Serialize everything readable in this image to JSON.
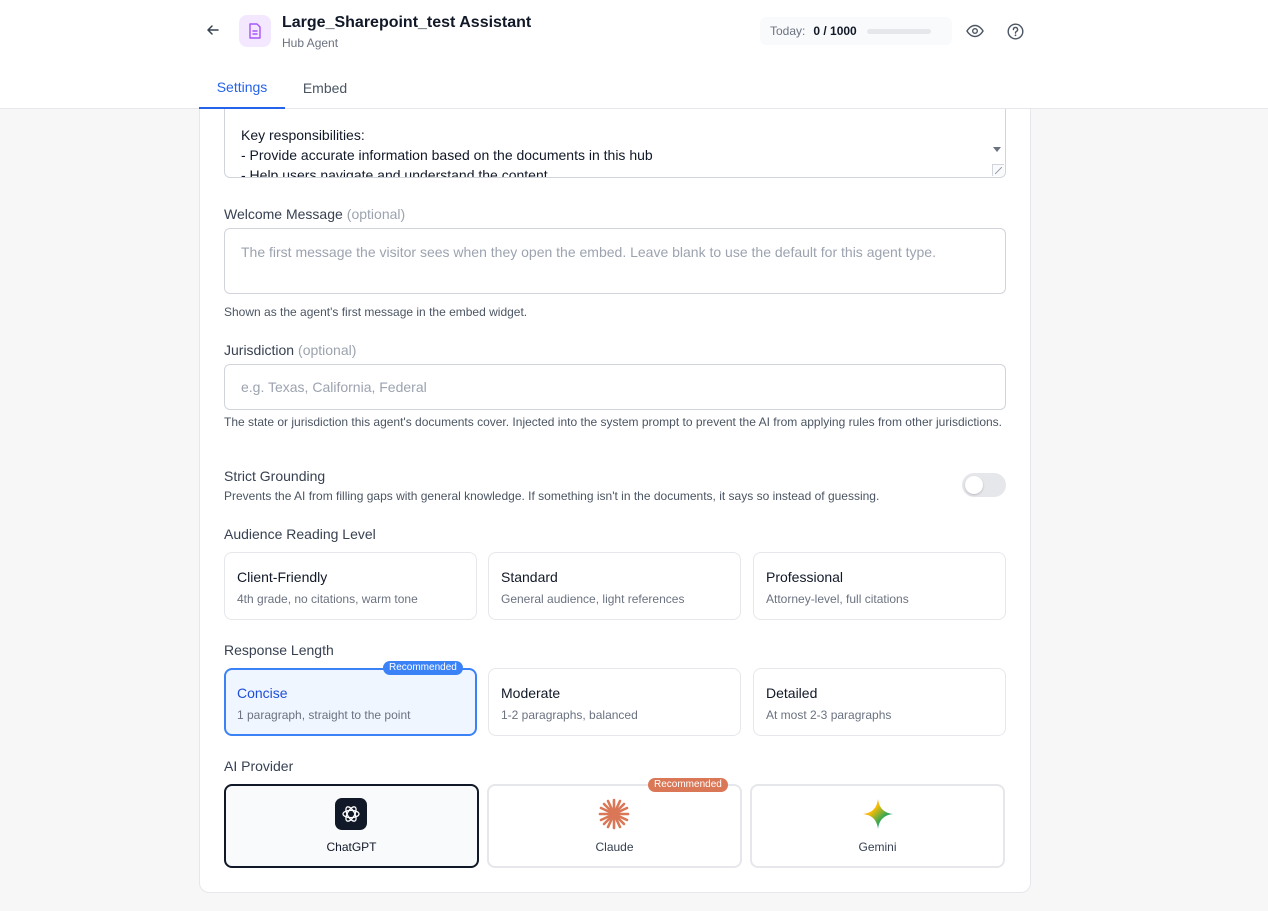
{
  "header": {
    "title": "Large_Sharepoint_test Assistant",
    "subtitle": "Hub Agent",
    "usage_label": "Today:",
    "usage_count": "0 / 1000",
    "usage_fraction": 0.0
  },
  "tabs": [
    {
      "label": "Settings",
      "active": true
    },
    {
      "label": "Embed",
      "active": false
    }
  ],
  "system_prompt": {
    "lines": [
      "Key responsibilities:",
      "- Provide accurate information based on the documents in this hub",
      "- Help users navigate and understand the content"
    ]
  },
  "welcome": {
    "label": "Welcome Message",
    "optional": "(optional)",
    "placeholder": "The first message the visitor sees when they open the embed. Leave blank to use the default for this agent type.",
    "help": "Shown as the agent's first message in the embed widget."
  },
  "jurisdiction": {
    "label": "Jurisdiction",
    "optional": "(optional)",
    "placeholder": "e.g. Texas, California, Federal",
    "help": "The state or jurisdiction this agent's documents cover. Injected into the system prompt to prevent the AI from applying rules from other jurisdictions."
  },
  "strict_grounding": {
    "label": "Strict Grounding",
    "help": "Prevents the AI from filling gaps with general knowledge. If something isn't in the documents, it says so instead of guessing.",
    "enabled": false
  },
  "reading_level": {
    "label": "Audience Reading Level",
    "options": [
      {
        "title": "Client-Friendly",
        "desc": "4th grade, no citations, warm tone"
      },
      {
        "title": "Standard",
        "desc": "General audience, light references"
      },
      {
        "title": "Professional",
        "desc": "Attorney-level, full citations"
      }
    ]
  },
  "response_length": {
    "label": "Response Length",
    "badge": "Recommended",
    "options": [
      {
        "title": "Concise",
        "desc": "1 paragraph, straight to the point",
        "selected": true
      },
      {
        "title": "Moderate",
        "desc": "1-2 paragraphs, balanced",
        "selected": false
      },
      {
        "title": "Detailed",
        "desc": "At most 2-3 paragraphs",
        "selected": false
      }
    ]
  },
  "ai_provider": {
    "label": "AI Provider",
    "badge": "Recommended",
    "options": [
      {
        "name": "ChatGPT",
        "icon": "chatgpt-logo-icon",
        "selected": true
      },
      {
        "name": "Claude",
        "icon": "claude-logo-icon",
        "selected": false
      },
      {
        "name": "Gemini",
        "icon": "gemini-logo-icon",
        "selected": false
      }
    ]
  },
  "colors": {
    "accent": "#2563eb",
    "selected_bg": "#eff6ff",
    "claude_orange": "#d97757",
    "agent_icon": "#a855f7"
  }
}
